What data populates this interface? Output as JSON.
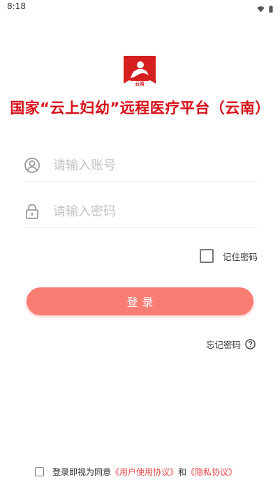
{
  "status_bar": {
    "time": "8:18",
    "icons": [
      "wifi-icon",
      "battery-icon"
    ]
  },
  "app": {
    "logo_text": "云南",
    "title": "国家“云上妇幼”远程医疗平台（云南）",
    "title_color": "#d80d17"
  },
  "login_form": {
    "account_placeholder": "请输入账号",
    "account_value": "",
    "password_placeholder": "请输入密码",
    "password_value": "",
    "remember_label": "记住密码",
    "remember_checked": false,
    "login_label": "登录",
    "forgot_label": "忘记密码"
  },
  "agreement": {
    "checked": false,
    "prefix": "登录即视为同意",
    "user_agreement": "《用户使用协议》",
    "and": "和",
    "privacy_agreement": "《隐私协议》"
  },
  "colors": {
    "accent": "#f77d73",
    "link": "#e84b4b",
    "placeholder": "#c2c2c2"
  }
}
